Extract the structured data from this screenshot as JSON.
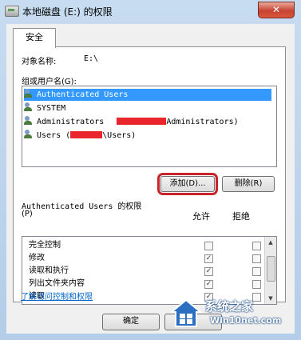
{
  "window": {
    "title": "本地磁盘 (E:) 的权限",
    "close_glyph": "✕"
  },
  "tabs": [
    {
      "label": "安全"
    }
  ],
  "object": {
    "label": "对象名称:",
    "value": "E:\\"
  },
  "groups": {
    "label": "组或用户名(G):",
    "items": [
      {
        "text": "Authenticated Users",
        "selected": true
      },
      {
        "text": "SYSTEM",
        "selected": false
      },
      {
        "text": "Administrators",
        "suffix": "Administrators)",
        "redacted": true,
        "selected": false
      },
      {
        "text": "Users (",
        "suffix": "\\Users)",
        "redacted": true,
        "selected": false
      }
    ]
  },
  "buttons": {
    "add": "添加(D)...",
    "remove": "删除(R)",
    "ok": "确定"
  },
  "permissions": {
    "label_line1": "Authenticated Users 的权限",
    "label_line2": "(P)",
    "allow_header": "允许",
    "deny_header": "拒绝",
    "rows": [
      {
        "name": "完全控制",
        "allow": false,
        "deny": false
      },
      {
        "name": "修改",
        "allow": true,
        "deny": false
      },
      {
        "name": "读取和执行",
        "allow": true,
        "deny": false
      },
      {
        "name": "列出文件夹内容",
        "allow": true,
        "deny": false
      },
      {
        "name": "读取",
        "allow": true,
        "deny": false
      }
    ]
  },
  "link": {
    "text": "了解访问控制和权限"
  },
  "watermark": {
    "line1": "系统之家",
    "line2": "Win10net.com"
  },
  "colors": {
    "selection": "#3399ff",
    "highlight_box": "#c8222a",
    "link": "#0066cc",
    "redaction": "#e8262b"
  }
}
